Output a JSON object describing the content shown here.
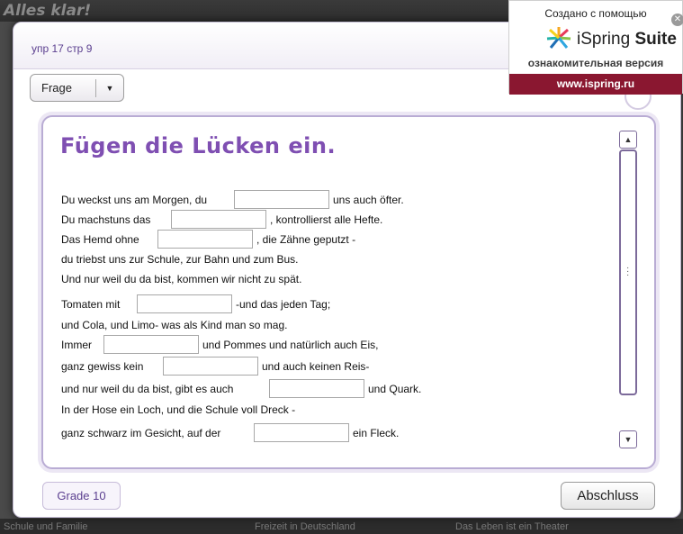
{
  "background": {
    "title": "Alles klar!",
    "bottom_items": [
      "Schule und Familie",
      "Freizeit in Deutschland",
      "Das Leben ist ein Theater"
    ]
  },
  "dialog": {
    "slide_title": "упр 17 стр 9",
    "frage_label": "Frage",
    "heading": "Fügen die Lücken ein.",
    "lines": [
      {
        "before": "Du weckst uns am Morgen, du",
        "after": "uns auch öfter.",
        "has_gap": true
      },
      {
        "before": "Du machstuns das",
        "after": ", kontrollierst alle Hefte.",
        "has_gap": true
      },
      {
        "before": "Das Hemd ohne",
        "after": ", die Zähne geputzt -",
        "has_gap": true
      },
      {
        "before": "du triebst uns zur Schule, zur Bahn und zum Bus.",
        "after": "",
        "has_gap": false
      },
      {
        "before": "Und nur weil du da bist, kommen wir nicht zu spät.",
        "after": "",
        "has_gap": false
      },
      {
        "before": "Tomaten mit",
        "after": "-und das jeden Tag;",
        "has_gap": true
      },
      {
        "before": "und Cola, und Limo- was als Kind man so mag.",
        "after": "",
        "has_gap": false
      },
      {
        "before": "Immer",
        "after": "und Pommes und natürlich auch Eis,",
        "has_gap": true
      },
      {
        "before": "ganz gewiss kein",
        "after": "und auch keinen Reis-",
        "has_gap": true
      },
      {
        "before": "und nur weil du da bist, gibt es auch",
        "after": "und Quark.",
        "has_gap": true
      },
      {
        "before": "In der Hose ein Loch, und die Schule voll Dreck -",
        "after": "",
        "has_gap": false
      },
      {
        "before": "ganz schwarz im Gesicht, auf der",
        "after": "ein Fleck.",
        "has_gap": true
      }
    ],
    "grade_label": "Grade 10",
    "abschluss_label": "Abschluss"
  },
  "watermark": {
    "created_with": "Создано с помощью",
    "brand_light": "iSpring",
    "brand_bold": "Suite",
    "trial": "ознакомительная версия",
    "url": "www.ispring.ru"
  },
  "colors": {
    "accent_purple": "#7f4fb2",
    "frame_border": "#b9acd4",
    "watermark_url_bg": "#8a1730"
  },
  "icons": {
    "dropdown": "chevron-down-icon",
    "close": "close-icon",
    "scroll_up": "arrow-up-icon",
    "scroll_down": "arrow-down-icon",
    "logo": "ispring-logo-icon"
  }
}
